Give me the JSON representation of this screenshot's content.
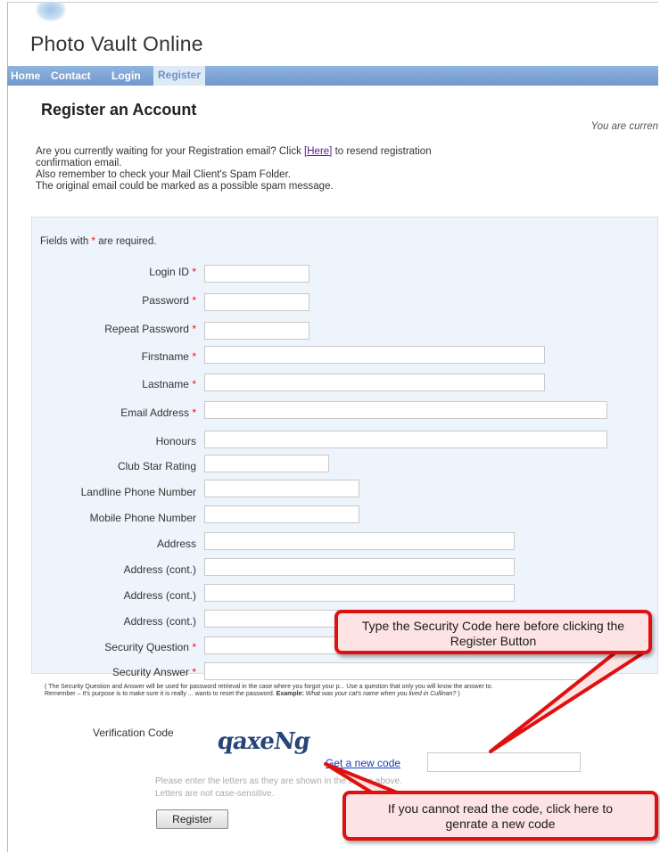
{
  "site": {
    "title": "Photo Vault Online"
  },
  "nav": [
    {
      "label": "Home"
    },
    {
      "label": "Contact"
    },
    {
      "label": "Login"
    },
    {
      "label": "Register"
    }
  ],
  "page": {
    "heading": "Register an Account",
    "status": "You are curren",
    "intro": {
      "line1_pre": "Are you currently waiting for your Registration email?  Click ",
      "line1_link": "[Here]",
      "line1_post": " to resend registration",
      "line2": "confirmation email.",
      "line3": "Also remember to check your Mail Client's Spam Folder.",
      "line4": "The original email could be marked as a possible spam message."
    }
  },
  "form": {
    "required_note_pre": "Fields with ",
    "required_star": "*",
    "required_note_post": " are required.",
    "fields": [
      {
        "label": "Login ID",
        "required": true
      },
      {
        "label": "Password",
        "required": true
      },
      {
        "label": "Repeat Password",
        "required": true
      },
      {
        "label": "Firstname",
        "required": true
      },
      {
        "label": "Lastname",
        "required": true
      },
      {
        "label": "Email Address",
        "required": true
      },
      {
        "label": "Honours",
        "required": false
      },
      {
        "label": "Club Star Rating",
        "required": false
      },
      {
        "label": "Landline Phone Number",
        "required": false
      },
      {
        "label": "Mobile Phone Number",
        "required": false
      },
      {
        "label": "Address",
        "required": false
      },
      {
        "label": "Address (cont.)",
        "required": false
      },
      {
        "label": "Address (cont.)",
        "required": false
      },
      {
        "label": "Address (cont.)",
        "required": false
      },
      {
        "label": "Security Question",
        "required": true
      },
      {
        "label": "Security Answer",
        "required": true
      }
    ],
    "security_note": "( The Security Question and Answer will be used for password retrieval in the case where you forgot your p... Use a question that only you will know the answer to. Remember – It's purpose is to make sure it is really ... wants to reset the password.",
    "security_note_example_label": "Example:",
    "security_note_example": "What was your cat's name when you lived in Cullinan?",
    "security_note_close": ")",
    "verification_label": "Verification Code",
    "captcha_text": "qaxeNg",
    "new_code_link": "Get a new code",
    "hint_line1": "Please enter the letters as they are shown in the image above.",
    "hint_line2": "Letters are not case-sensitive.",
    "register_button": "Register"
  },
  "callouts": {
    "security_code": "Type the Security Code here before clicking the Register Button",
    "new_code": "If you cannot read the code, click here to genrate a new code"
  },
  "colors": {
    "nav_bg": "#7aa2d4",
    "form_bg": "#eef4fb",
    "required_star": "#e11111",
    "callout_border": "#e01010",
    "callout_fill": "#fde3e3"
  }
}
